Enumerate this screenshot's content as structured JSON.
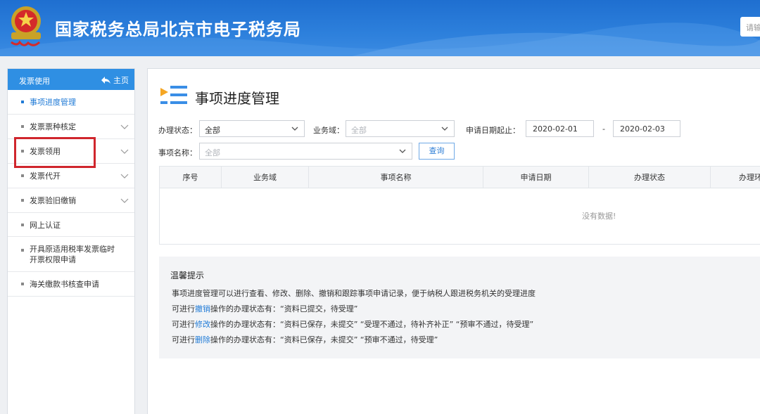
{
  "header": {
    "site_title": "国家税务总局北京市电子税务局",
    "search_placeholder": "请输"
  },
  "sidebar": {
    "title": "发票使用",
    "home_label": "主页",
    "items": [
      {
        "label": "事项进度管理",
        "active": true,
        "expandable": false
      },
      {
        "label": "发票票种核定",
        "active": false,
        "expandable": true
      },
      {
        "label": "发票领用",
        "active": false,
        "expandable": true
      },
      {
        "label": "发票代开",
        "active": false,
        "expandable": true
      },
      {
        "label": "发票验旧缴销",
        "active": false,
        "expandable": true
      },
      {
        "label": "网上认证",
        "active": false,
        "expandable": false
      },
      {
        "label": "开具原适用税率发票临时开票权限申请",
        "active": false,
        "expandable": false
      },
      {
        "label": "海关缴款书核查申请",
        "active": false,
        "expandable": false
      }
    ]
  },
  "main": {
    "page_title": "事项进度管理",
    "filters": {
      "status_label": "办理状态：",
      "status_value": "全部",
      "domain_label": "业务域：",
      "domain_value": "全部",
      "date_label": "申请日期起止：",
      "date_from": "2020-02-01",
      "date_separator": "-",
      "date_to": "2020-02-03",
      "item_label": "事项名称：",
      "item_value": "全部",
      "query_button": "查询"
    },
    "table": {
      "columns": [
        "序号",
        "业务域",
        "事项名称",
        "申请日期",
        "办理状态",
        "办理环"
      ],
      "empty_text": "没有数据!"
    },
    "tips": {
      "title": "温馨提示",
      "line1": "事项进度管理可以进行查看、修改、删除、撤销和跟踪事项申请记录，便于纳税人跟进税务机关的受理进度",
      "line2_pre": "可进行",
      "line2_action": "撤销",
      "line2_post": "操作的办理状态有：“资料已提交，待受理”",
      "line3_pre": "可进行",
      "line3_action": "修改",
      "line3_post": "操作的办理状态有：“资料已保存，未提交”  “受理不通过，待补齐补正”  “预审不通过，待受理”",
      "line4_pre": "可进行",
      "line4_action": "删除",
      "line4_post": "操作的办理状态有：“资料已保存，未提交”  “预审不通过，待受理”"
    }
  },
  "colors": {
    "header_blue": "#2d80dc",
    "accent": "#1f7ad6",
    "highlight_red": "#d0262d"
  }
}
